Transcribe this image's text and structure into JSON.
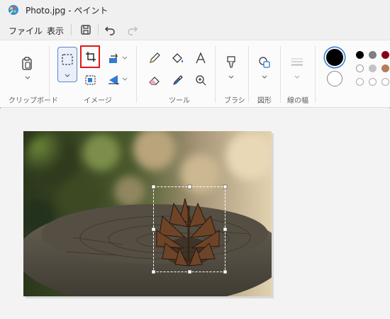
{
  "window": {
    "title": "Photo.jpg - ペイント"
  },
  "menu": {
    "file": "ファイル",
    "view": "表示"
  },
  "ribbon": {
    "groups": {
      "clipboard": "クリップボード",
      "image": "イメージ",
      "tools": "ツール",
      "brush": "ブラシ",
      "shapes": "図形",
      "line_width": "線の幅"
    }
  },
  "colors": {
    "primary": "#000000",
    "secondary": "#ffffff",
    "palette_row1": [
      "#000000",
      "#7f7f7f",
      "#880015"
    ],
    "palette_row2": [
      "#ffffff",
      "#c3c3c3",
      "#b97a57"
    ],
    "highlight": "#e01818",
    "selected_tool_border": "#5b86c5"
  },
  "icons": [
    "paint-app-icon",
    "save-icon",
    "undo-icon",
    "redo-icon",
    "clipboard-icon",
    "select-icon",
    "crop-icon",
    "resize-icon",
    "rotate-icon",
    "flip-icon",
    "pencil-icon",
    "fill-icon",
    "text-icon",
    "eraser-icon",
    "color-picker-icon",
    "magnifier-icon",
    "brush-icon",
    "shapes-icon",
    "line-width-icon"
  ]
}
